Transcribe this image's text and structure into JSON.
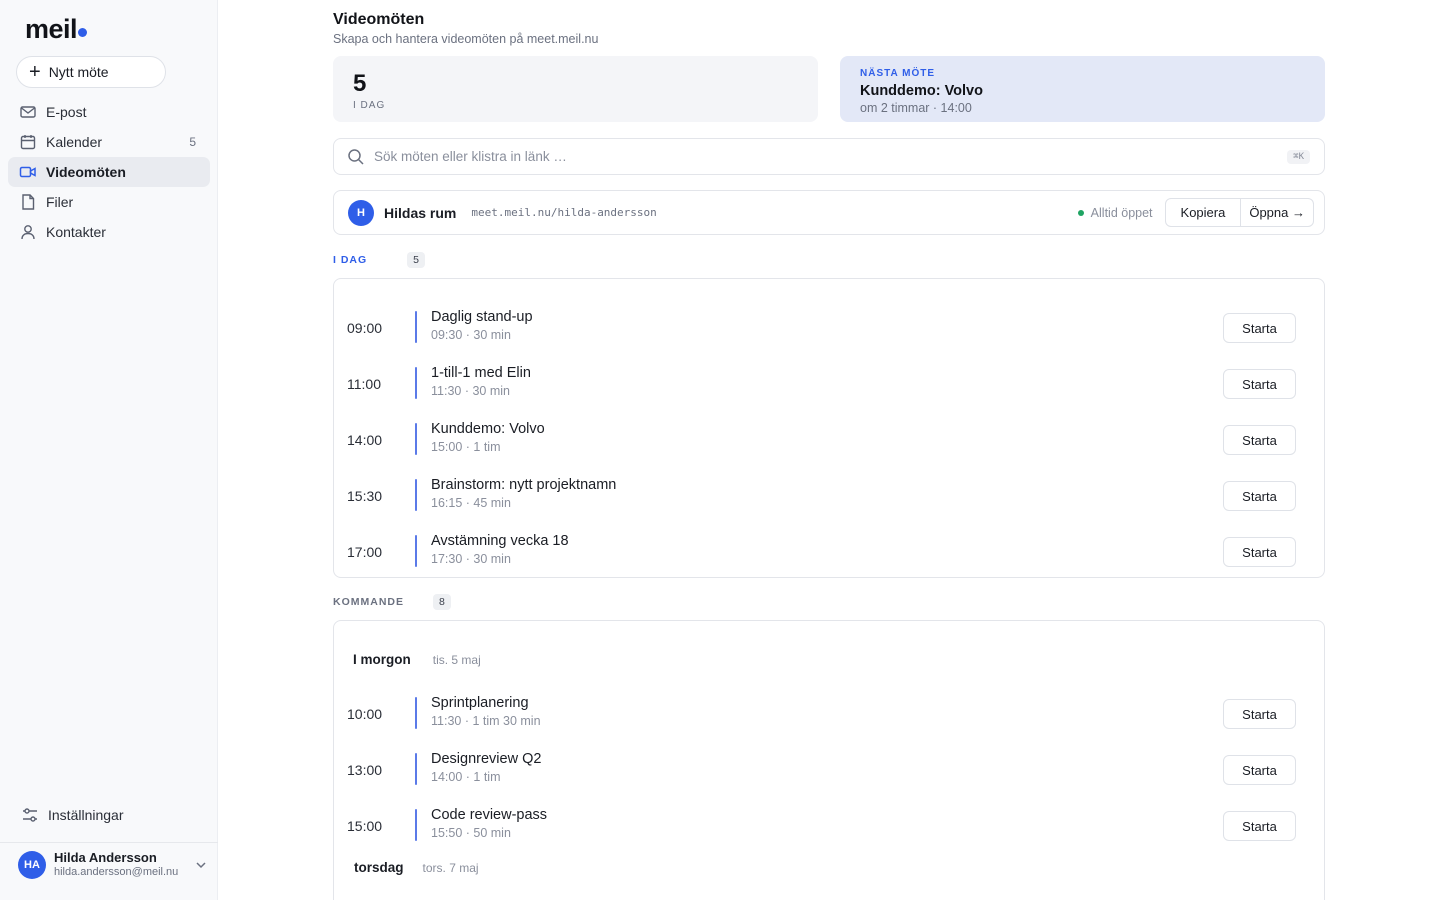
{
  "app": {
    "logo_text": "meil"
  },
  "sidebar": {
    "new_button": "Nytt möte",
    "items": [
      {
        "label": "E-post",
        "count": "",
        "icon": "mail-icon"
      },
      {
        "label": "Kalender",
        "count": "5",
        "icon": "calendar-icon"
      },
      {
        "label": "Videomöten",
        "count": "",
        "icon": "video-icon",
        "active": true
      },
      {
        "label": "Filer",
        "count": "",
        "icon": "file-icon"
      },
      {
        "label": "Kontakter",
        "count": "",
        "icon": "user-icon"
      }
    ],
    "settings_label": "Inställningar",
    "user": {
      "initials": "HA",
      "name": "Hilda Andersson",
      "email": "hilda.andersson@meil.nu"
    }
  },
  "header": {
    "title": "Videomöten",
    "subtitle": "Skapa och hantera videomöten på meet.meil.nu"
  },
  "stats": {
    "count": "5",
    "label": "I DAG"
  },
  "next_meeting": {
    "label": "NÄSTA MÖTE",
    "title": "Kunddemo: Volvo",
    "subtitle": "om 2 timmar · 14:00"
  },
  "search": {
    "placeholder": "Sök möten eller klistra in länk …",
    "shortcut": "⌘K"
  },
  "room": {
    "initial": "H",
    "name": "Hildas rum",
    "link": "meet.meil.nu/hilda-andersson",
    "status": "Alltid öppet",
    "copy_label": "Kopiera",
    "open_label": "Öppna →"
  },
  "today": {
    "label": "I DAG",
    "count": "5",
    "meetings": [
      {
        "time": "09:00",
        "title": "Daglig stand-up",
        "sub": "09:30 · 30 min",
        "action": "Starta"
      },
      {
        "time": "11:00",
        "title": "1-till-1 med Elin",
        "sub": "11:30 · 30 min",
        "action": "Starta"
      },
      {
        "time": "14:00",
        "title": "Kunddemo: Volvo",
        "sub": "15:00 · 1 tim",
        "action": "Starta"
      },
      {
        "time": "15:30",
        "title": "Brainstorm: nytt projektnamn",
        "sub": "16:15 · 45 min",
        "action": "Starta"
      },
      {
        "time": "17:00",
        "title": "Avstämning vecka 18",
        "sub": "17:30 · 30 min",
        "action": "Starta"
      }
    ]
  },
  "upcoming": {
    "label": "KOMMANDE",
    "count": "8",
    "days": [
      {
        "day": "I morgon",
        "date": "tis. 5 maj",
        "meetings": [
          {
            "time": "10:00",
            "title": "Sprintplanering",
            "sub": "11:30 · 1 tim 30 min",
            "action": "Starta"
          },
          {
            "time": "13:00",
            "title": "Designreview Q2",
            "sub": "14:00 · 1 tim",
            "action": "Starta"
          },
          {
            "time": "15:00",
            "title": "Code review-pass",
            "sub": "15:50 · 50 min",
            "action": "Starta"
          }
        ]
      },
      {
        "day": "torsdag",
        "date": "tors. 7 maj",
        "meetings": []
      }
    ]
  },
  "colors": {
    "accent": "#2f5ee8",
    "status_green": "#1fa463",
    "event_bar": "#5b7ae8"
  }
}
